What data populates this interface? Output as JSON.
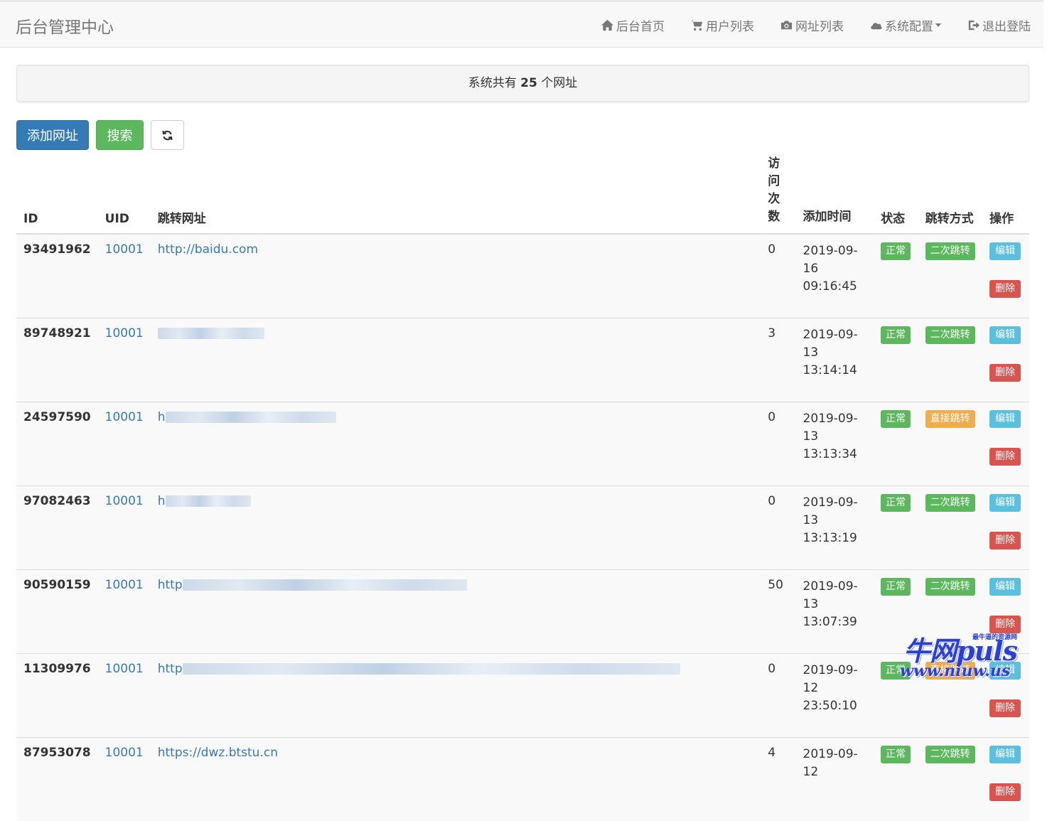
{
  "navbar": {
    "brand": "后台管理中心",
    "items": [
      {
        "label": "后台首页",
        "icon": "home-icon"
      },
      {
        "label": "用户列表",
        "icon": "cart-icon"
      },
      {
        "label": "网址列表",
        "icon": "camera-icon"
      },
      {
        "label": "系统配置",
        "icon": "cloud-icon"
      },
      {
        "label": "退出登陆",
        "icon": "logout-icon"
      }
    ]
  },
  "summary": {
    "prefix": "系统共有",
    "count": "25",
    "suffix": "个网址"
  },
  "toolbar": {
    "add_label": "添加网址",
    "search_label": "搜索",
    "refresh_icon": "refresh-icon"
  },
  "table": {
    "headers": {
      "id": "ID",
      "uid": "UID",
      "url": "跳转网址",
      "visits": "访问次数",
      "time": "添加时间",
      "status": "状态",
      "mode": "跳转方式",
      "op": "操作"
    },
    "edit_label": "编辑",
    "delete_label": "删除",
    "rows": [
      {
        "id": "93491962",
        "uid": "10001",
        "url": "http://baidu.com",
        "visits": "0",
        "date": "2019-09-16",
        "clock": "09:16:45",
        "status": "正常",
        "mode": "二次跳转"
      },
      {
        "id": "89748921",
        "uid": "10001",
        "url": "",
        "visits": "3",
        "date": "2019-09-13",
        "clock": "13:14:14",
        "status": "正常",
        "mode": "二次跳转"
      },
      {
        "id": "24597590",
        "uid": "10001",
        "url": "h",
        "visits": "0",
        "date": "2019-09-13",
        "clock": "13:13:34",
        "status": "正常",
        "mode": "直接跳转"
      },
      {
        "id": "97082463",
        "uid": "10001",
        "url": "h",
        "visits": "0",
        "date": "2019-09-13",
        "clock": "13:13:19",
        "status": "正常",
        "mode": "二次跳转"
      },
      {
        "id": "90590159",
        "uid": "10001",
        "url": "http",
        "visits": "50",
        "date": "2019-09-13",
        "clock": "13:07:39",
        "status": "正常",
        "mode": "二次跳转"
      },
      {
        "id": "11309976",
        "uid": "10001",
        "url": "http",
        "visits": "0",
        "date": "2019-09-12",
        "clock": "23:50:10",
        "status": "正常",
        "mode": "直接跳转"
      },
      {
        "id": "87953078",
        "uid": "10001",
        "url": "https://dwz.btstu.cn",
        "visits": "4",
        "date": "2019-09-12",
        "clock": "",
        "status": "正常",
        "mode": "二次跳转"
      }
    ]
  },
  "colors": {
    "primary": "#337ab7",
    "success": "#5cb85c",
    "warning": "#f0ad4e",
    "info": "#5bc0de",
    "danger": "#d9534f"
  },
  "watermark": {
    "main": "牛网puls",
    "tag": "最牛逼的资源网",
    "url": "www.niuw.us"
  }
}
